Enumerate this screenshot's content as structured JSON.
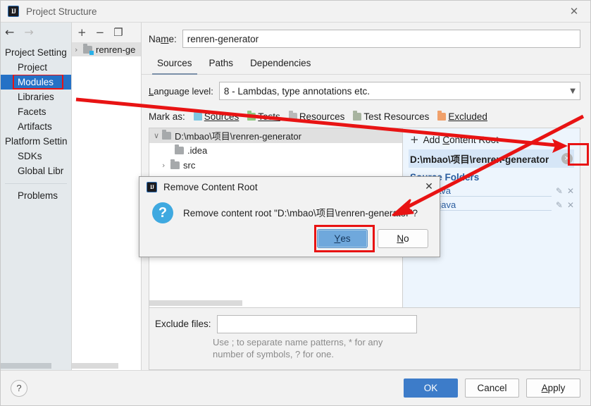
{
  "window": {
    "title": "Project Structure",
    "app_icon": "intellij-idea-icon",
    "close_icon": "close-icon"
  },
  "nav": {
    "back_icon": "arrow-left-icon",
    "forward_icon": "arrow-right-icon",
    "groups": [
      {
        "label": "Project Setting",
        "items": [
          {
            "label": "Project",
            "selected": false
          },
          {
            "label": "Modules",
            "selected": true
          },
          {
            "label": "Libraries",
            "selected": false
          },
          {
            "label": "Facets",
            "selected": false
          },
          {
            "label": "Artifacts",
            "selected": false
          }
        ]
      },
      {
        "label": "Platform Settin",
        "items": [
          {
            "label": "SDKs",
            "selected": false
          },
          {
            "label": "Global Libr",
            "selected": false
          }
        ]
      }
    ],
    "footer_items": [
      {
        "label": "Problems"
      }
    ]
  },
  "module_tree": {
    "toolbar": [
      {
        "icon": "plus-icon",
        "glyph": "+"
      },
      {
        "icon": "minus-icon",
        "glyph": "−"
      },
      {
        "icon": "copy-icon",
        "glyph": "❐"
      }
    ],
    "rows": [
      {
        "label": "renren-ge",
        "expander": "›",
        "icon": "module-folder-icon"
      }
    ]
  },
  "detail": {
    "name_label": "Name:",
    "name_value": "renren-generator",
    "tabs": [
      {
        "label": "Sources",
        "active": true
      },
      {
        "label": "Paths",
        "active": false
      },
      {
        "label": "Dependencies",
        "active": false
      }
    ],
    "language_level_label": "Language level:",
    "language_level_value": "8 - Lambdas, type annotations etc.",
    "dropdown_icon": "chevron-down-icon",
    "mark_as_label": "Mark as:",
    "mark_as_options": [
      {
        "label": "Sources",
        "mnemonic": "S",
        "rest": "ources",
        "color": "#7ec8e3"
      },
      {
        "label": "Tests",
        "mnemonic": "T",
        "rest": "ests",
        "color": "#8fc97f"
      },
      {
        "label": "Resources",
        "mnemonic": "",
        "rest": "Resources",
        "color": "#b9b9b9"
      },
      {
        "label": "Test Resources",
        "mnemonic": "",
        "rest": "Test Resources",
        "color": "#a8b4a0"
      },
      {
        "label": "Excluded",
        "mnemonic": "E",
        "rest": "xcluded",
        "color": "#f0a06a"
      }
    ],
    "tree": [
      {
        "label": "D:\\mbao\\项目\\renren-generator",
        "expander": "∨",
        "indent": 0,
        "selected": true
      },
      {
        "label": ".idea",
        "expander": "",
        "indent": 1,
        "selected": false
      },
      {
        "label": "src",
        "expander": "›",
        "indent": 1,
        "selected": false
      }
    ],
    "content_roots": {
      "add_label": "Add Content Root",
      "add_icon": "plus-icon",
      "root_path": "D:\\mbao\\项目\\renren-generator",
      "remove_root_icon": "remove-circle-icon",
      "source_folders_title": "Source Folders",
      "source_folders": [
        {
          "label": "\\test\\java",
          "edit_icon": "pencil-icon",
          "remove_icon": "close-icon"
        },
        {
          "label": "\\main\\java",
          "edit_icon": "pencil-icon",
          "remove_icon": "close-icon"
        }
      ]
    },
    "exclude_label": "Exclude files:",
    "exclude_value": "",
    "exclude_hint_line1": "Use ; to separate name patterns, * for any",
    "exclude_hint_line2": "number of symbols, ? for one."
  },
  "footer": {
    "help_icon": "help-icon",
    "help_glyph": "?",
    "ok": "OK",
    "cancel": "Cancel",
    "apply_mnemonic": "A",
    "apply_rest": "pply"
  },
  "modal": {
    "title": "Remove Content Root",
    "icon": "intellij-idea-icon",
    "close_icon": "close-icon",
    "question_icon": "question-icon",
    "question_glyph": "?",
    "message": "Remove content root \"D:\\mbao\\项目\\renren-generator\"?",
    "yes_mnemonic": "Y",
    "yes_rest": "es",
    "no_mnemonic": "N",
    "no_rest": "o"
  },
  "annotations": {
    "highlight_color": "#e81313",
    "arrow_color": "#e81313",
    "boxes": [
      {
        "name": "modules-nav-highlight"
      },
      {
        "name": "remove-content-root-button-highlight"
      },
      {
        "name": "yes-button-highlight"
      }
    ],
    "arrows": [
      {
        "name": "arrow-to-remove-content-root"
      },
      {
        "name": "arrow-to-yes-button"
      }
    ]
  }
}
